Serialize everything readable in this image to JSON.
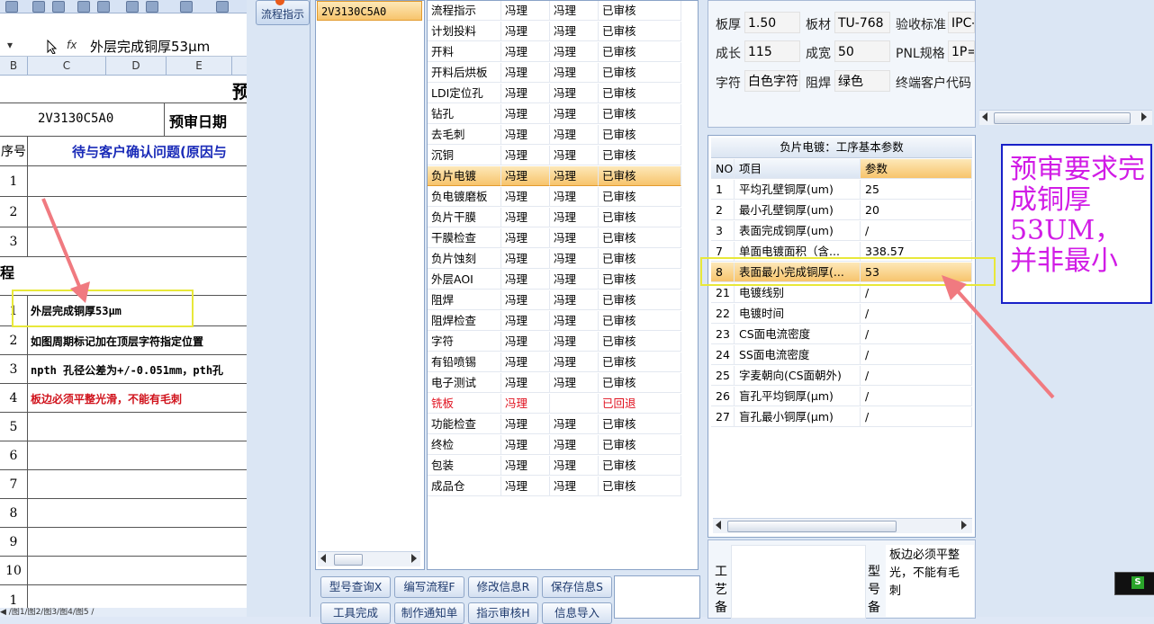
{
  "excel": {
    "formula_cell": "外层完成铜厚53μm",
    "fx": "fx",
    "columns": [
      "B",
      "C",
      "D",
      "E"
    ],
    "title_char": "预",
    "doc_code": "2V3130C5A0",
    "review_date_label": "预审日期",
    "seq_header": "序号",
    "question_header": "待与客户确认问题(原因与",
    "rows_top": [
      "1",
      "2",
      "3"
    ],
    "section_label": "程",
    "rows": [
      {
        "num": "1",
        "text": "外层完成铜厚53μm",
        "color": "#000000"
      },
      {
        "num": "2",
        "text": "如图周期标记加在顶层字符指定位置",
        "color": "#000000"
      },
      {
        "num": "3",
        "text": "npth 孔径公差为+/-0.051mm，pth孔",
        "color": "#000000"
      },
      {
        "num": "4",
        "text": "板边必须平整光滑，不能有毛刺",
        "color": "#d0121b"
      },
      {
        "num": "5",
        "text": "",
        "color": "#000000"
      },
      {
        "num": "6",
        "text": "",
        "color": "#000000"
      },
      {
        "num": "7",
        "text": "",
        "color": "#000000"
      },
      {
        "num": "8",
        "text": "",
        "color": "#000000"
      },
      {
        "num": "9",
        "text": "",
        "color": "#000000"
      },
      {
        "num": "10",
        "text": "",
        "color": "#000000"
      },
      {
        "num": "1",
        "text": "",
        "color": "#000000"
      }
    ],
    "sheet_tabs": "◀ /图1/图2/图3/图4/图5 /"
  },
  "sidebar": {
    "flow_button": "流程指示"
  },
  "card_list": {
    "selected": "2V3130C5A0"
  },
  "process_list": [
    {
      "step": "流程指示",
      "a": "冯理",
      "b": "冯理",
      "status": "已审核"
    },
    {
      "step": "计划投料",
      "a": "冯理",
      "b": "冯理",
      "status": "已审核"
    },
    {
      "step": "开料",
      "a": "冯理",
      "b": "冯理",
      "status": "已审核"
    },
    {
      "step": "开料后烘板",
      "a": "冯理",
      "b": "冯理",
      "status": "已审核"
    },
    {
      "step": "LDI定位孔",
      "a": "冯理",
      "b": "冯理",
      "status": "已审核"
    },
    {
      "step": "钻孔",
      "a": "冯理",
      "b": "冯理",
      "status": "已审核"
    },
    {
      "step": "去毛刺",
      "a": "冯理",
      "b": "冯理",
      "status": "已审核"
    },
    {
      "step": "沉铜",
      "a": "冯理",
      "b": "冯理",
      "status": "已审核"
    },
    {
      "step": "负片电镀",
      "a": "冯理",
      "b": "冯理",
      "status": "已审核"
    },
    {
      "step": "负电镀磨板",
      "a": "冯理",
      "b": "冯理",
      "status": "已审核"
    },
    {
      "step": "负片干膜",
      "a": "冯理",
      "b": "冯理",
      "status": "已审核"
    },
    {
      "step": "干膜检查",
      "a": "冯理",
      "b": "冯理",
      "status": "已审核"
    },
    {
      "step": "负片蚀刻",
      "a": "冯理",
      "b": "冯理",
      "status": "已审核"
    },
    {
      "step": "外层AOI",
      "a": "冯理",
      "b": "冯理",
      "status": "已审核"
    },
    {
      "step": "阻焊",
      "a": "冯理",
      "b": "冯理",
      "status": "已审核"
    },
    {
      "step": "阻焊检查",
      "a": "冯理",
      "b": "冯理",
      "status": "已审核"
    },
    {
      "step": "字符",
      "a": "冯理",
      "b": "冯理",
      "status": "已审核"
    },
    {
      "step": "有铅喷锡",
      "a": "冯理",
      "b": "冯理",
      "status": "已审核"
    },
    {
      "step": "电子测试",
      "a": "冯理",
      "b": "冯理",
      "status": "已审核"
    },
    {
      "step": "铣板",
      "a": "冯理",
      "b": "",
      "status": "已回退"
    },
    {
      "step": "功能检查",
      "a": "冯理",
      "b": "冯理",
      "status": "已审核"
    },
    {
      "step": "终检",
      "a": "冯理",
      "b": "冯理",
      "status": "已审核"
    },
    {
      "step": "包装",
      "a": "冯理",
      "b": "冯理",
      "status": "已审核"
    },
    {
      "step": "成品仓",
      "a": "冯理",
      "b": "冯理",
      "status": "已审核"
    }
  ],
  "buttons": {
    "row1": [
      "型号查询X",
      "编写流程F",
      "修改信息R",
      "保存信息S"
    ],
    "row2": [
      "工具完成",
      "制作通知单",
      "指示审核H",
      "信息导入"
    ]
  },
  "info": {
    "thickness_label": "板厚",
    "thickness": "1.50",
    "material_label": "板材",
    "material": "TU-768",
    "standard_label": "验收标准",
    "standard": "IPC-",
    "length_label": "成长",
    "length": "115",
    "width_label": "成宽",
    "width": "50",
    "pnl_label": "PNL规格",
    "pnl": "1P=",
    "silkscreen_label": "字符",
    "silkscreen": "白色字符",
    "soldermask_label": "阻焊",
    "soldermask": "绿色",
    "endcode_label": "终端客户代码"
  },
  "params": {
    "title": "负片电镀：工序基本参数",
    "headers": {
      "no": "NO",
      "item": "项目",
      "value": "参数"
    },
    "rows": [
      {
        "no": "1",
        "item": "平均孔壁铜厚(um)",
        "value": "25"
      },
      {
        "no": "2",
        "item": "最小孔壁铜厚(um)",
        "value": "20"
      },
      {
        "no": "3",
        "item": "表面完成铜厚(um)",
        "value": "/"
      },
      {
        "no": "7",
        "item": "单面电镀面积（含...",
        "value": "338.57"
      },
      {
        "no": "8",
        "item": "表面最小完成铜厚(...",
        "value": "53"
      },
      {
        "no": "21",
        "item": "电镀线别",
        "value": "/"
      },
      {
        "no": "22",
        "item": "电镀时间",
        "value": "/"
      },
      {
        "no": "23",
        "item": "CS面电流密度",
        "value": "/"
      },
      {
        "no": "24",
        "item": "SS面电流密度",
        "value": "/"
      },
      {
        "no": "25",
        "item": "字麦朝向(CS面朝外)",
        "value": "/"
      },
      {
        "no": "26",
        "item": "盲孔平均铜厚(μm)",
        "value": "/"
      },
      {
        "no": "27",
        "item": "盲孔最小铜厚(μm)",
        "value": "/"
      }
    ]
  },
  "bottom": {
    "craft_label": "工艺备",
    "model_label": "型号备",
    "note": "板边必须平整光，不能有毛刺"
  },
  "annotation": {
    "text": "预审要求完成铜厚53UM，并非最小",
    "color": "#d11ce6"
  }
}
